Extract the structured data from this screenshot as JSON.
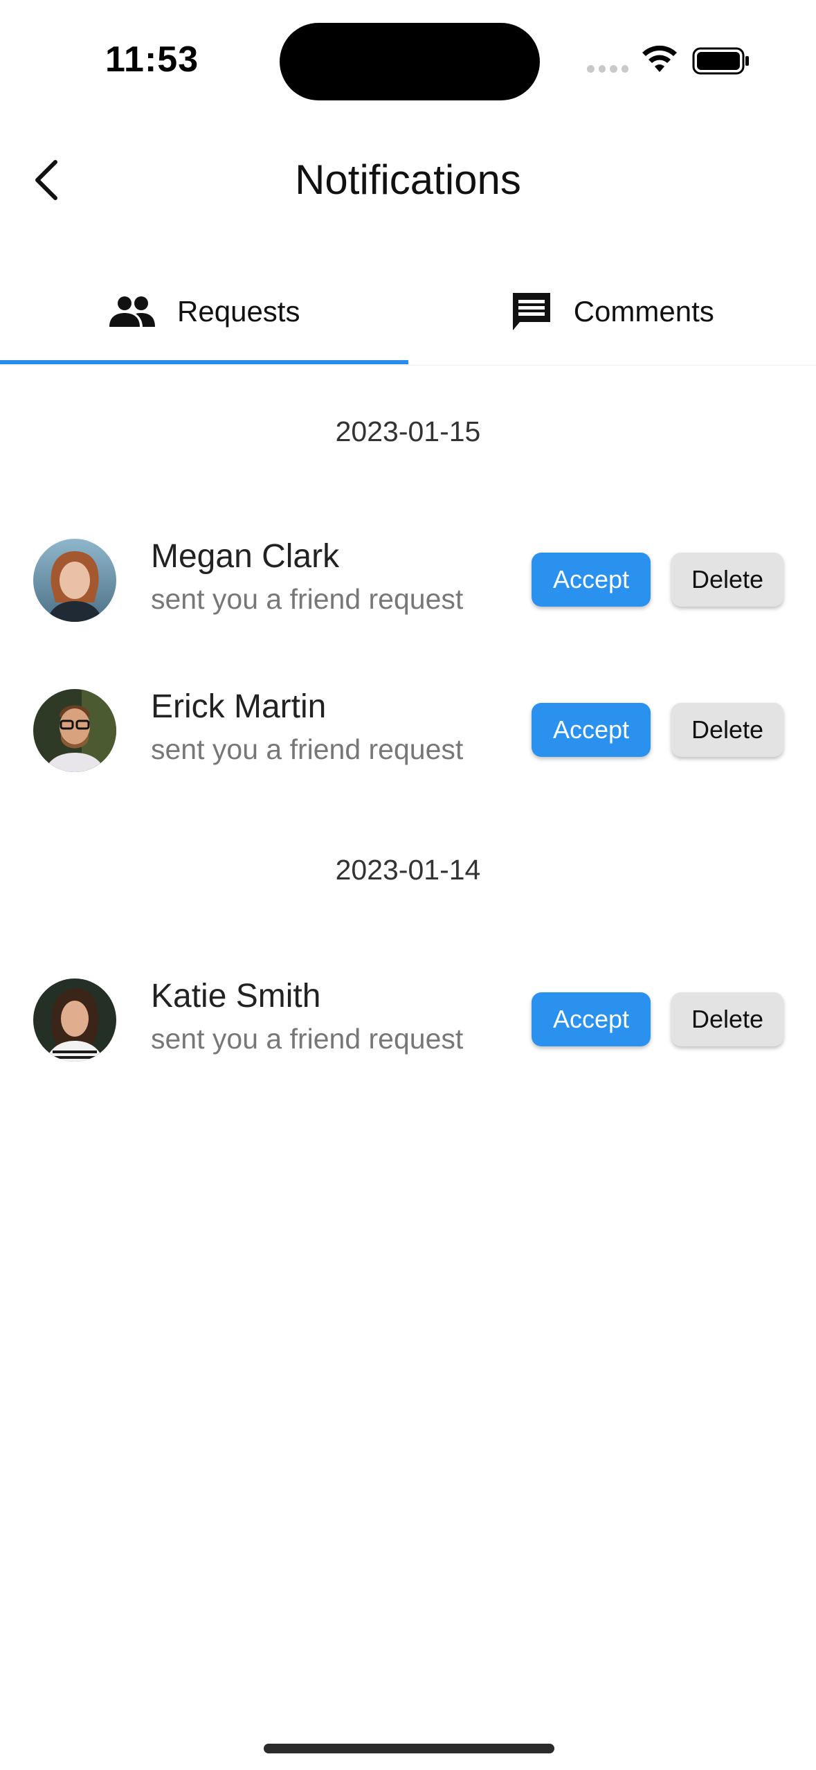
{
  "status_bar": {
    "time": "11:53"
  },
  "header": {
    "title": "Notifications",
    "back_icon": "chevron-left-icon"
  },
  "tabs": [
    {
      "label": "Requests",
      "icon": "people-icon",
      "active": true
    },
    {
      "label": "Comments",
      "icon": "comment-icon",
      "active": false
    }
  ],
  "groups": [
    {
      "date": "2023-01-15",
      "requests": [
        {
          "name": "Megan Clark",
          "subtitle": "sent you a friend request",
          "accept_label": "Accept",
          "delete_label": "Delete"
        },
        {
          "name": "Erick Martin",
          "subtitle": "sent you a friend request",
          "accept_label": "Accept",
          "delete_label": "Delete"
        }
      ]
    },
    {
      "date": "2023-01-14",
      "requests": [
        {
          "name": "Katie Smith",
          "subtitle": "sent you a friend request",
          "accept_label": "Accept",
          "delete_label": "Delete"
        }
      ]
    }
  ],
  "colors": {
    "accent": "#2a8cea",
    "accept_bg": "#2a92ee",
    "delete_bg": "#e3e3e3"
  }
}
